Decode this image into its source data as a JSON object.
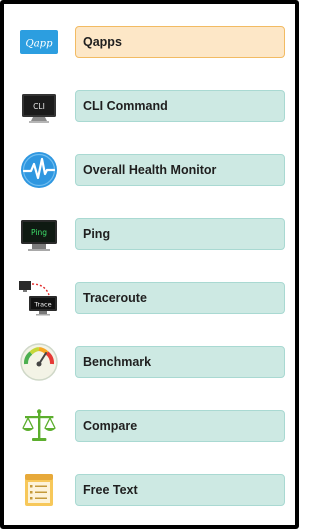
{
  "items": [
    {
      "label": "Qapps",
      "icon": "qapp-icon",
      "icon_text": "Qapp"
    },
    {
      "label": "CLI Command",
      "icon": "cli-monitor-icon",
      "icon_text": "CLI"
    },
    {
      "label": "Overall Health Monitor",
      "icon": "health-monitor-icon"
    },
    {
      "label": "Ping",
      "icon": "ping-monitor-icon",
      "icon_text": "Ping"
    },
    {
      "label": "Traceroute",
      "icon": "traceroute-icon",
      "icon_text": "Trace"
    },
    {
      "label": "Benchmark",
      "icon": "gauge-icon"
    },
    {
      "label": "Compare",
      "icon": "scales-icon"
    },
    {
      "label": "Free Text",
      "icon": "notepad-icon"
    }
  ],
  "colors": {
    "button_bg": "#cde9e3",
    "button_border": "#a9d9d2",
    "active_bg": "#fde7c7",
    "active_border": "#f2bb63",
    "frame": "#000000"
  }
}
